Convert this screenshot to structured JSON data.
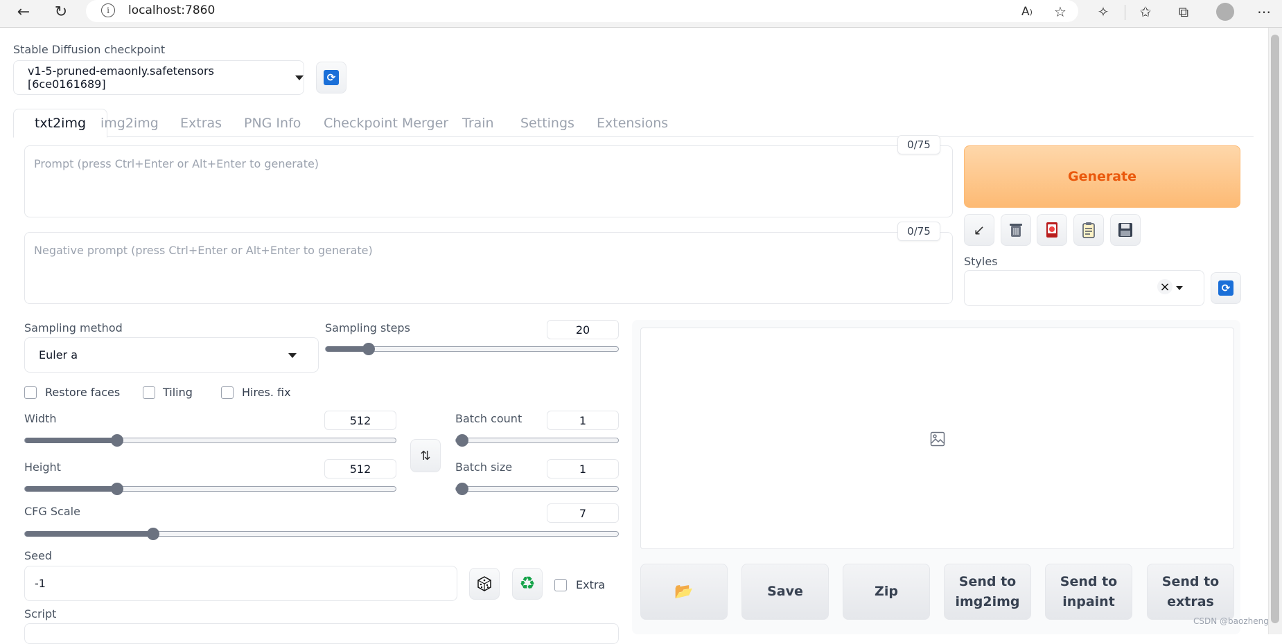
{
  "browser": {
    "url": "localhost:7860"
  },
  "checkpoint": {
    "label": "Stable Diffusion checkpoint",
    "value": "v1-5-pruned-emaonly.safetensors [6ce0161689]"
  },
  "tabs": [
    {
      "label": "txt2img"
    },
    {
      "label": "img2img"
    },
    {
      "label": "Extras"
    },
    {
      "label": "PNG Info"
    },
    {
      "label": "Checkpoint Merger"
    },
    {
      "label": "Train"
    },
    {
      "label": "Settings"
    },
    {
      "label": "Extensions"
    }
  ],
  "prompt": {
    "placeholder": "Prompt (press Ctrl+Enter or Alt+Enter to generate)",
    "token_count": "0/75"
  },
  "negative_prompt": {
    "placeholder": "Negative prompt (press Ctrl+Enter or Alt+Enter to generate)",
    "token_count": "0/75"
  },
  "generate": {
    "label": "Generate"
  },
  "styles": {
    "label": "Styles",
    "clear": "×"
  },
  "sampling": {
    "method_label": "Sampling method",
    "method_value": "Euler a",
    "steps_label": "Sampling steps",
    "steps_value": "20",
    "steps_fraction": 0.13
  },
  "checkboxes": {
    "restore_faces": "Restore faces",
    "tiling": "Tiling",
    "hires_fix": "Hires. fix",
    "extra": "Extra"
  },
  "width": {
    "label": "Width",
    "value": "512",
    "fraction": 0.24
  },
  "height": {
    "label": "Height",
    "value": "512",
    "fraction": 0.24
  },
  "batch_count": {
    "label": "Batch count",
    "value": "1",
    "fraction": 0.0
  },
  "batch_size": {
    "label": "Batch size",
    "value": "1",
    "fraction": 0.0
  },
  "cfg_scale": {
    "label": "CFG Scale",
    "value": "7",
    "fraction": 0.21
  },
  "seed": {
    "label": "Seed",
    "value": "-1"
  },
  "script": {
    "label": "Script"
  },
  "output_buttons": {
    "save": "Save",
    "zip": "Zip",
    "send_img2img_1": "Send to",
    "send_img2img_2": "img2img",
    "send_inpaint_1": "Send to",
    "send_inpaint_2": "inpaint",
    "send_extras_1": "Send to",
    "send_extras_2": "extras"
  },
  "watermark": "CSDN @baozheng",
  "colors": {
    "accent": "#ea580c",
    "generate_bg": "#fdba74",
    "refresh_icon": "#1a6fd8"
  }
}
